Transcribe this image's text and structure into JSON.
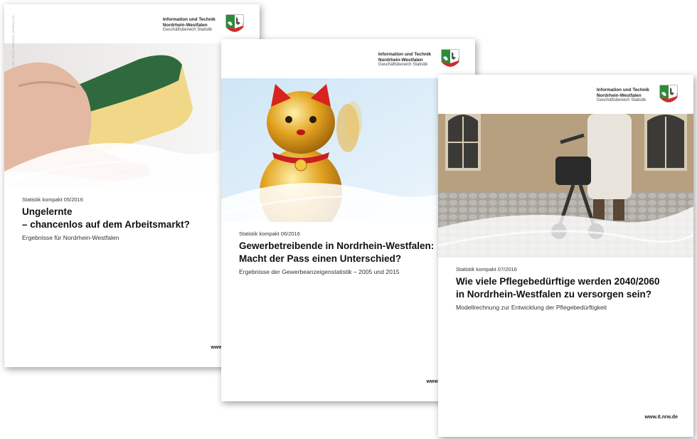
{
  "org": {
    "line1": "Information und Technik",
    "line2": "Nordrhein-Westfalen",
    "line3": "Geschäftsbereich Statistik"
  },
  "covers": [
    {
      "series": "Statistik kompakt 05/2016",
      "title": [
        "Ungelernte",
        "– chancenlos auf dem Arbeitsmarkt?"
      ],
      "subtitle": "Ergebnisse für Nordrhein-Westfalen",
      "website": "www.it.nrw.de",
      "photo": "hand-holding-sponge",
      "photo_credit": "Foto: Michal Jarmoluk | pixabay.com"
    },
    {
      "series": "Statistik kompakt 06/2016",
      "title": [
        "Gewerbetreibende in Nordrhein-Westfalen:",
        "Macht der Pass einen Unterschied?"
      ],
      "subtitle": "Ergebnisse der Gewerbeanzeigenstatistik – 2005 und 2015",
      "website": "www.it.nrw.de",
      "photo": "golden-lucky-cat"
    },
    {
      "series": "Statistik kompakt 07/2016",
      "title": [
        "Wie viele Pflegebedürftige werden 2040/2060",
        "in Nordrhein-Westfalen zu versorgen sein?"
      ],
      "subtitle": "Modellrechnung zur Entwicklung der Pflegebedürftigkeit",
      "website": "www.it.nrw.de",
      "photo": "elderly-person-with-rollator"
    }
  ],
  "colors": {
    "crest_green": "#2e8b3a",
    "crest_red": "#d42a2a",
    "text_dark": "#111111"
  }
}
